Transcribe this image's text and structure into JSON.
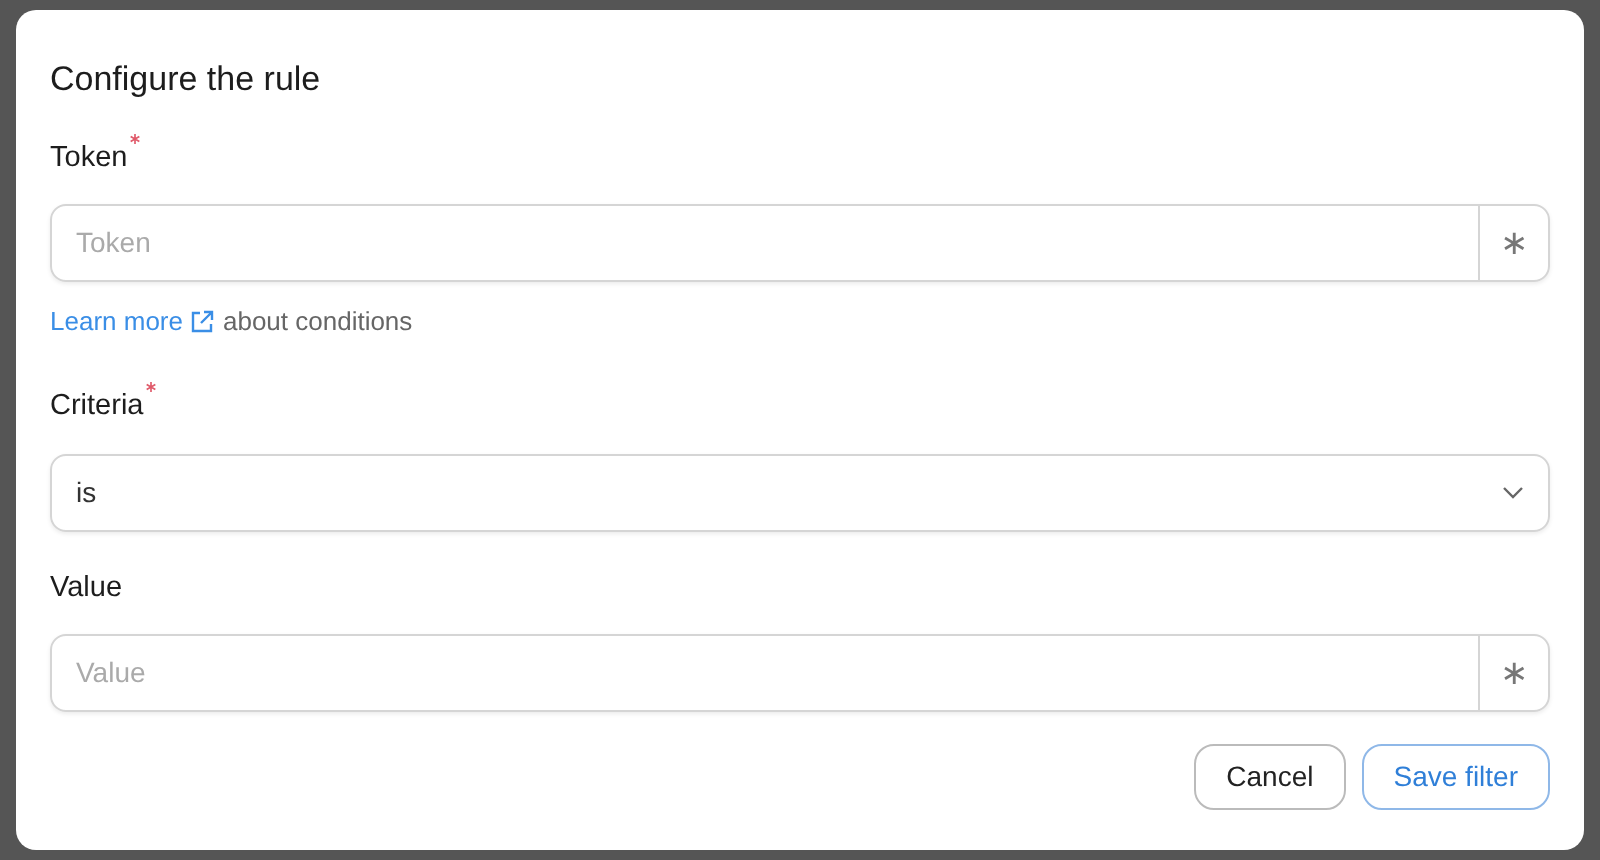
{
  "dialog": {
    "title": "Configure the rule",
    "fields": [
      {
        "kind": "input",
        "label": "Token",
        "required": true,
        "placeholder": "Token",
        "addon": "∗",
        "help": {
          "link": "Learn more",
          "text": "about conditions"
        }
      },
      {
        "kind": "select",
        "label": "Criteria",
        "required": true,
        "value": "is"
      },
      {
        "kind": "input",
        "label": "Value",
        "required": false,
        "placeholder": "Value",
        "addon": "∗"
      }
    ],
    "buttons": [
      {
        "label": "Cancel",
        "kind": "secondary"
      },
      {
        "label": "Save filter",
        "kind": "primary"
      }
    ]
  }
}
